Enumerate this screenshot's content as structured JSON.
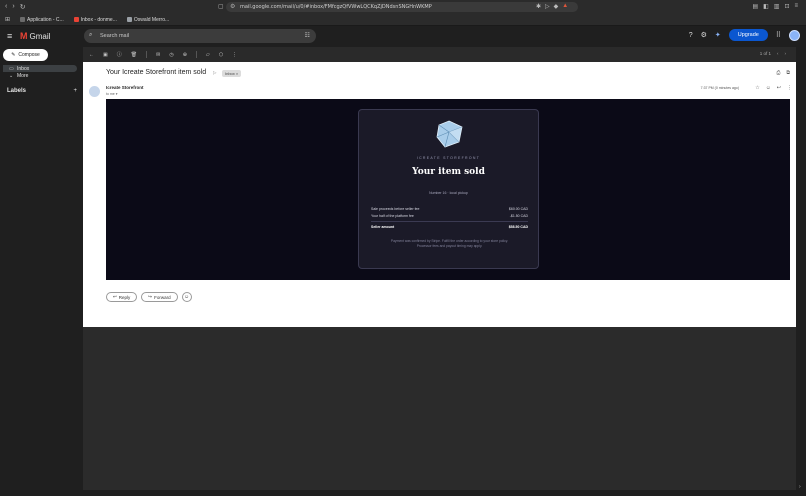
{
  "browser": {
    "url": "mail.google.com/mail/u/0/#inbox/FMfcgzQfVWwLQCKqZjDNdsnSNGHnWKMP",
    "bookmarks": [
      {
        "label": "Application - C...",
        "color": "#6b6b6b"
      },
      {
        "label": "Inbox - donme...",
        "color": "#ea4335"
      },
      {
        "label": "Oswald Merro...",
        "color": "#9aa0a6"
      }
    ]
  },
  "header": {
    "app_name": "Gmail",
    "search_placeholder": "Search mail",
    "upgrade_label": "Upgrade"
  },
  "sidebar": {
    "compose_label": "Compose",
    "items": [
      {
        "label": "Inbox"
      },
      {
        "label": "More"
      }
    ],
    "labels_heading": "Labels",
    "labels_add": "+"
  },
  "toolbar": {
    "pager": "1 of 1"
  },
  "message": {
    "subject": "Your Icreate Storefront item sold",
    "tag": "Inbox ×",
    "sender": "Icreate Storefront",
    "to": "to me ▾",
    "time": "7:37 PM (0 minutes ago)",
    "reply_label": "Reply",
    "forward_label": "Forward"
  },
  "email": {
    "brand": "ICREATE STOREFRONT",
    "title": "Your item sold",
    "subline": "Number 16 · local pickup",
    "rows": [
      {
        "label": "Sale proceeds before seller fee",
        "value": "$60.00 CAD"
      },
      {
        "label": "Your half of the platform fee",
        "value": "-$1.50 CAD"
      },
      {
        "label": "Seller amount",
        "value": "$58.50 CAD"
      }
    ],
    "note_line1": "Payment was confirmed by Stripe. Fulfill the order according to your store policy.",
    "note_line2": "Processor fees and payout timing may apply."
  },
  "colors": {
    "accent": "#0b57d0",
    "email_bg": "#0b0a17",
    "card_bg": "#1b1a28"
  }
}
